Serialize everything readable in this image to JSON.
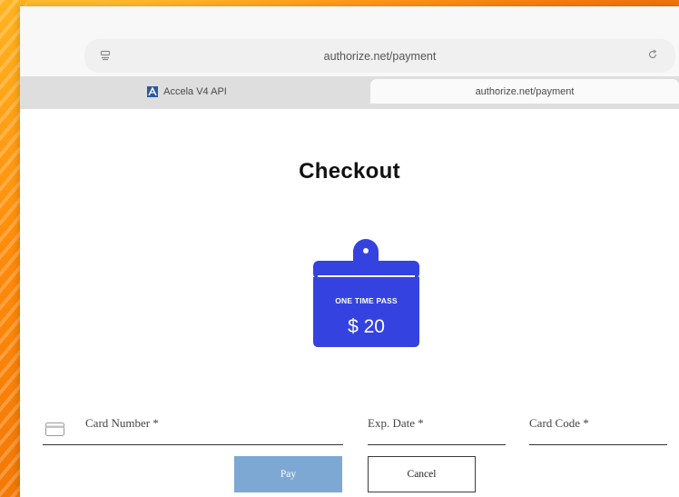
{
  "browser": {
    "address_url": "authorize.net/payment",
    "tabs": [
      {
        "label": "Accela V4 API",
        "active": false,
        "favicon": "accela-icon"
      },
      {
        "label": "authorize.net/payment",
        "active": true
      }
    ]
  },
  "page": {
    "title": "Checkout",
    "pass": {
      "label": "ONE TIME PASS",
      "price": "$ 20",
      "color": "#3443e0"
    }
  },
  "form": {
    "card_number_label": "Card Number *",
    "exp_date_label": "Exp. Date *",
    "card_code_label": "Card Code *"
  },
  "buttons": {
    "pay_label": "Pay",
    "cancel_label": "Cancel",
    "pay_color": "#7da8d3"
  },
  "colors": {
    "background": "#f58c17",
    "accent": "#3443e0"
  }
}
